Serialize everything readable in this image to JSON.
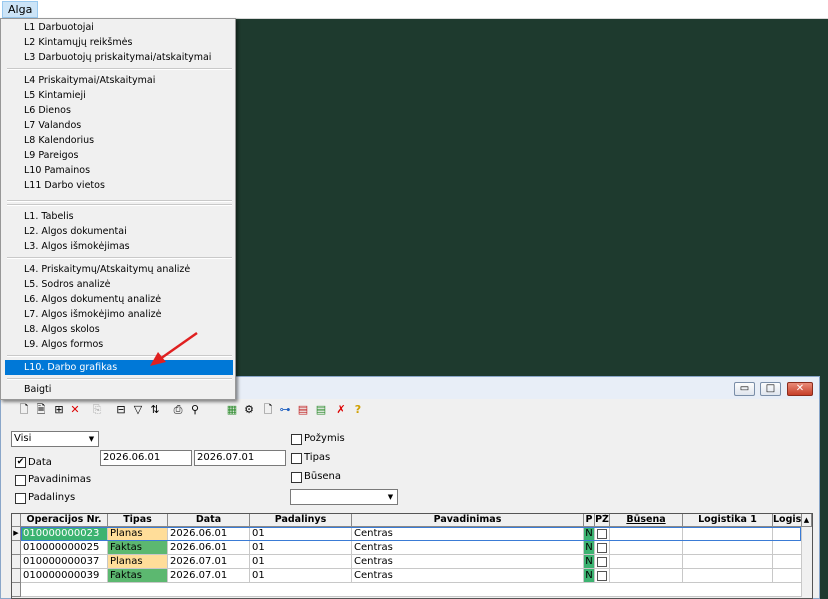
{
  "menubar": {
    "alga": "Alga"
  },
  "menu": {
    "group1": [
      "L1 Darbuotojai",
      "L2 Kintamųjų reikšmės",
      "L3 Darbuotojų priskaitymai/atskaitymai"
    ],
    "group2": [
      "L4 Priskaitymai/Atskaitymai",
      "L5 Kintamieji",
      "L6 Dienos",
      "L7 Valandos",
      "L8 Kalendorius",
      "L9 Pareigos",
      "L10 Pamainos",
      "L11 Darbo vietos"
    ],
    "group3": [
      "L1. Tabelis",
      "L2. Algos dokumentai",
      "L3. Algos išmokėjimas"
    ],
    "group4": [
      "L4. Priskaitymų/Atskaitymų analizė",
      "L5. Sodros analizė",
      "L6. Algos dokumentų analizė",
      "L7. Algos išmokėjimo analizė",
      "L8. Algos skolos",
      "L9. Algos formos"
    ],
    "selected": "L10. Darbo grafikas",
    "exit": "Baigti"
  },
  "window": {
    "buttons": {
      "minimize": "▭",
      "maximize": "□",
      "close": "✕"
    }
  },
  "toolbar": {
    "icons": [
      "new-document-icon",
      "copy-document-icon",
      "tree-check-icon",
      "delete-icon",
      "paste-icon",
      "filter-tree-icon",
      "filter-icon",
      "sort-icon",
      "print-icon",
      "find-icon",
      "add-schedule-icon",
      "generate-icon",
      "template-icon",
      "hierarchy-icon",
      "calendar-red-icon",
      "calendar-green-icon",
      "cancel-icon",
      "help-icon"
    ]
  },
  "filters": {
    "scope_value": "Visi",
    "data_label": "Data",
    "data_checked": true,
    "pavadinimas_label": "Pavadinimas",
    "padalinys_label": "Padalinys",
    "date_from": "2026.06.01",
    "date_to": "2026.07.01",
    "pozymis_label": "Požymis",
    "tipas_label": "Tipas",
    "busena_label": "Būsena",
    "busena_value": ""
  },
  "grid": {
    "columns": [
      "Operacijos Nr.",
      "Tipas",
      "Data",
      "Padalinys",
      "Pavadinimas",
      "P",
      "PŽ",
      "Būsena",
      "Logistika 1",
      "Logist"
    ],
    "rows": [
      {
        "nr": "010000000023",
        "tipas": "Planas",
        "data": "2026.06.01",
        "padalinys": "01",
        "pavadinimas": "Centras",
        "p": "N"
      },
      {
        "nr": "010000000025",
        "tipas": "Faktas",
        "data": "2026.06.01",
        "padalinys": "01",
        "pavadinimas": "Centras",
        "p": "N"
      },
      {
        "nr": "010000000037",
        "tipas": "Planas",
        "data": "2026.07.01",
        "padalinys": "01",
        "pavadinimas": "Centras",
        "p": "N"
      },
      {
        "nr": "010000000039",
        "tipas": "Faktas",
        "data": "2026.07.01",
        "padalinys": "01",
        "pavadinimas": "Centras",
        "p": "N"
      }
    ]
  },
  "colors": {
    "accent": "#0078d7",
    "planas": "#ffdd99",
    "faktas": "#5cb870",
    "arrow": "#e02020"
  }
}
